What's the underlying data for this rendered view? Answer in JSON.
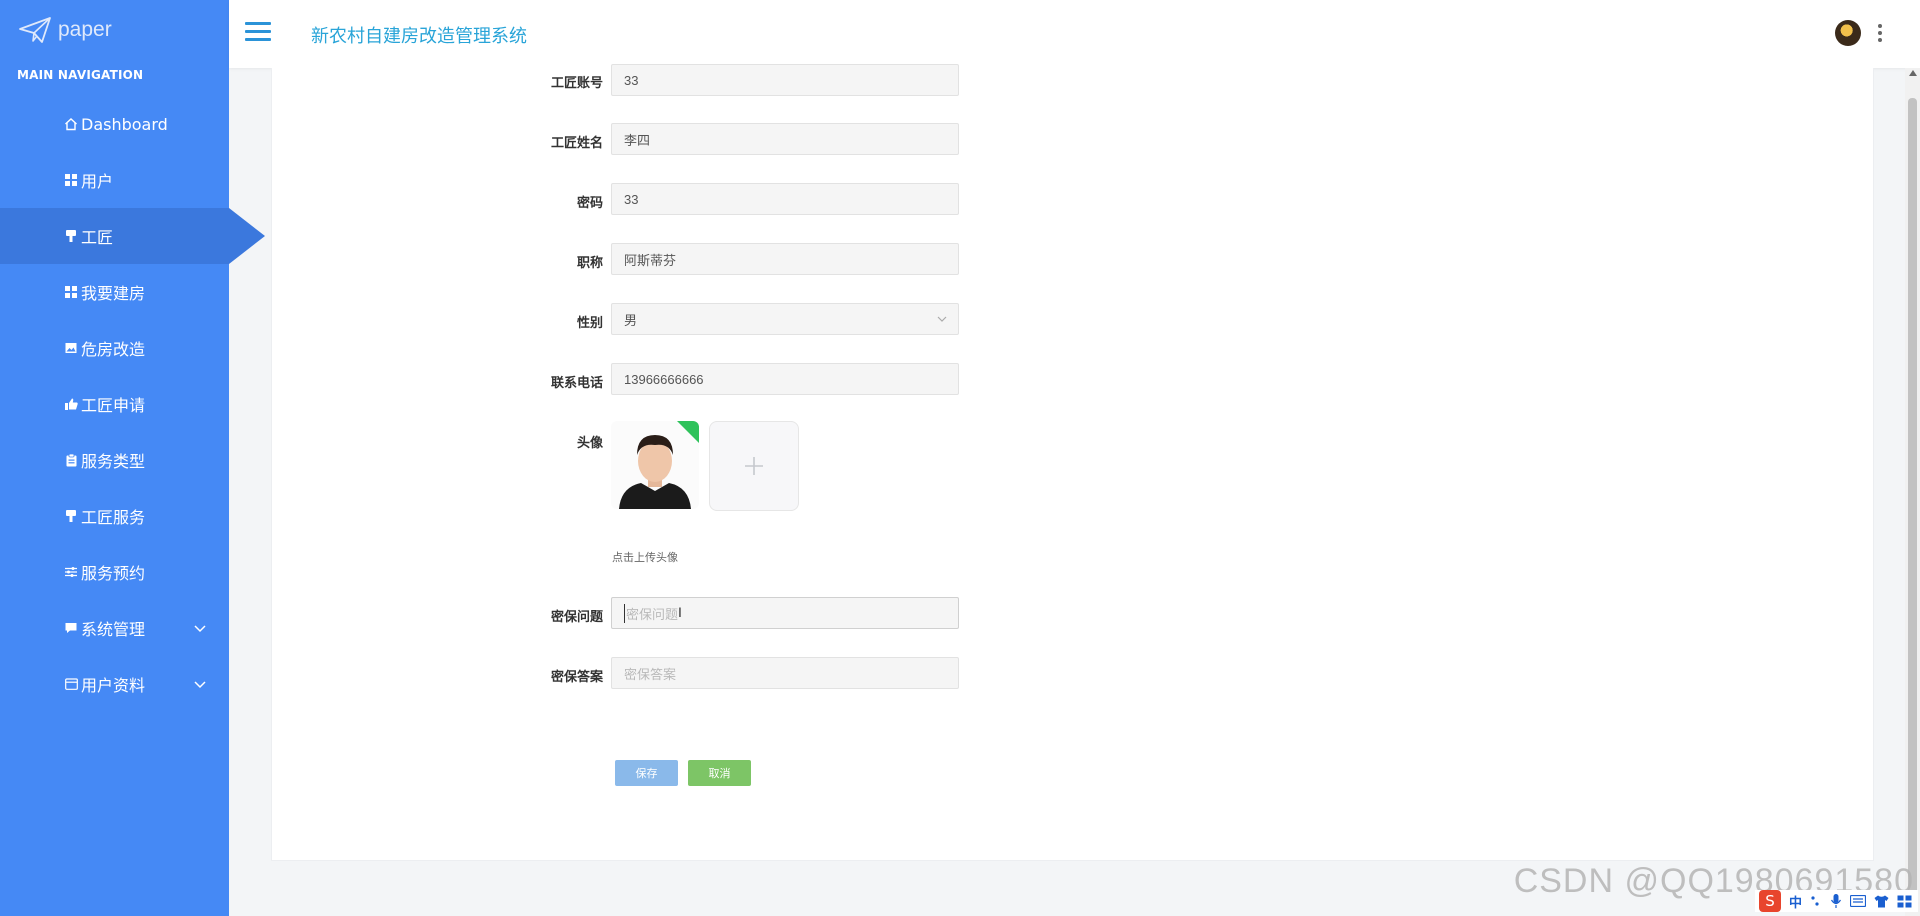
{
  "sidebar": {
    "brand": "paper",
    "heading": "MAIN NAVIGATION",
    "items": [
      {
        "label": "Dashboard",
        "icon": "home-icon"
      },
      {
        "label": "用户",
        "icon": "grid-icon"
      },
      {
        "label": "工匠",
        "icon": "brush-icon",
        "active": true
      },
      {
        "label": "我要建房",
        "icon": "grid-icon"
      },
      {
        "label": "危房改造",
        "icon": "image-icon"
      },
      {
        "label": "工匠申请",
        "icon": "thumbs-up-icon"
      },
      {
        "label": "服务类型",
        "icon": "clipboard-icon"
      },
      {
        "label": "工匠服务",
        "icon": "brush-icon"
      },
      {
        "label": "服务预约",
        "icon": "sliders-icon"
      },
      {
        "label": "系统管理",
        "icon": "chat-icon",
        "expandable": true
      },
      {
        "label": "用户资料",
        "icon": "calendar-icon",
        "expandable": true
      }
    ]
  },
  "header": {
    "title": "新农村自建房改造管理系统"
  },
  "form": {
    "account_label": "工匠账号",
    "account_value": "33",
    "name_label": "工匠姓名",
    "name_value": "李四",
    "password_label": "密码",
    "password_value": "33",
    "title_label": "职称",
    "title_value": "阿斯蒂芬",
    "gender_label": "性别",
    "gender_value": "男",
    "phone_label": "联系电话",
    "phone_value": "13966666666",
    "avatar_label": "头像",
    "avatar_hint": "点击上传头像",
    "question_label": "密保问题",
    "question_placeholder": "密保问题",
    "answer_label": "密保答案",
    "answer_placeholder": "密保答案",
    "save_label": "保存",
    "cancel_label": "取消"
  },
  "watermark": "CSDN @QQ1980691580",
  "ime": {
    "chinese": "中"
  },
  "colors": {
    "sidebar": "#4589f5",
    "sidebar_active": "#3b78dd",
    "title": "#29a4d8",
    "save": "#8ab9ea",
    "cancel": "#7dc566"
  }
}
